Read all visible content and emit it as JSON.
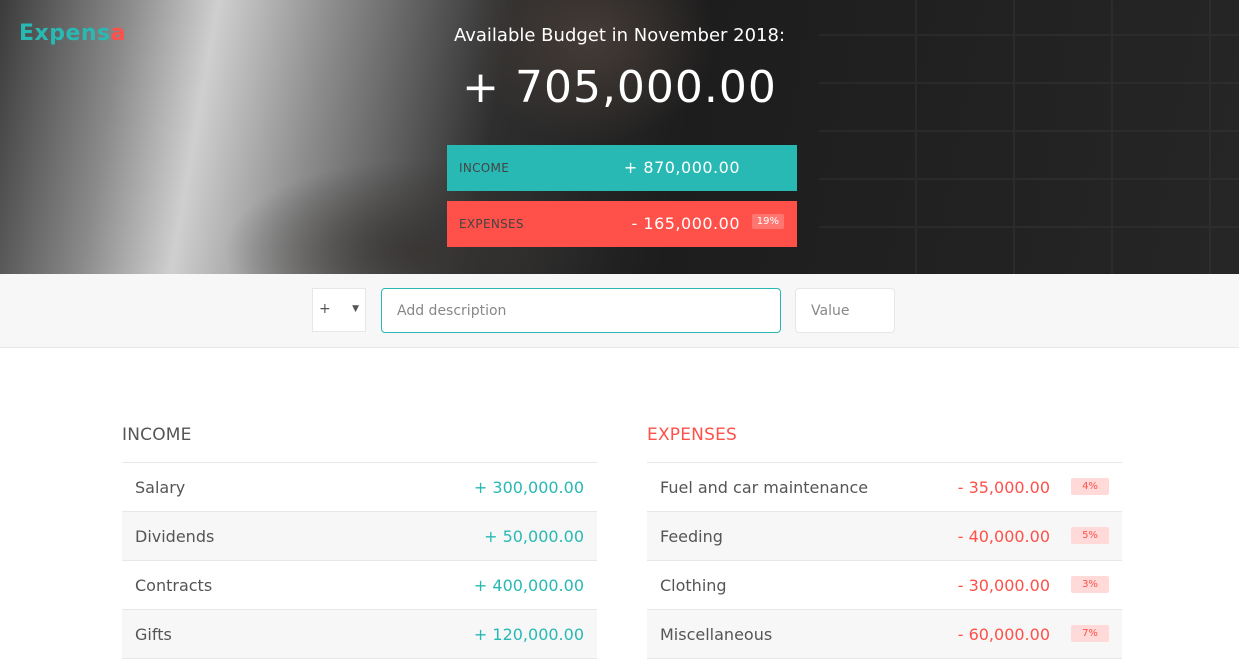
{
  "app": {
    "logo_main": "Expens",
    "logo_accent": "a",
    "colors": {
      "income": "#28b9b5",
      "expenses": "#ff5049"
    }
  },
  "header": {
    "title": "Available Budget in November 2018:",
    "budget_value": "+ 705,000.00",
    "income": {
      "label": "INCOME",
      "value": "+ 870,000.00"
    },
    "expenses": {
      "label": "EXPENSES",
      "value": "- 165,000.00",
      "percentage": "19%"
    }
  },
  "add_form": {
    "type_value": "+",
    "type_arrow": "▼",
    "description_placeholder": "Add description",
    "value_placeholder": "Value"
  },
  "income_list": {
    "title": "INCOME",
    "items": [
      {
        "description": "Salary",
        "value": "+ 300,000.00"
      },
      {
        "description": "Dividends",
        "value": "+ 50,000.00"
      },
      {
        "description": "Contracts",
        "value": "+ 400,000.00"
      },
      {
        "description": "Gifts",
        "value": "+ 120,000.00"
      }
    ]
  },
  "expenses_list": {
    "title": "EXPENSES",
    "items": [
      {
        "description": "Fuel and car maintenance",
        "value": "- 35,000.00",
        "percentage": "4%"
      },
      {
        "description": "Feeding",
        "value": "- 40,000.00",
        "percentage": "5%"
      },
      {
        "description": "Clothing",
        "value": "- 30,000.00",
        "percentage": "3%"
      },
      {
        "description": "Miscellaneous",
        "value": "- 60,000.00",
        "percentage": "7%"
      }
    ]
  }
}
